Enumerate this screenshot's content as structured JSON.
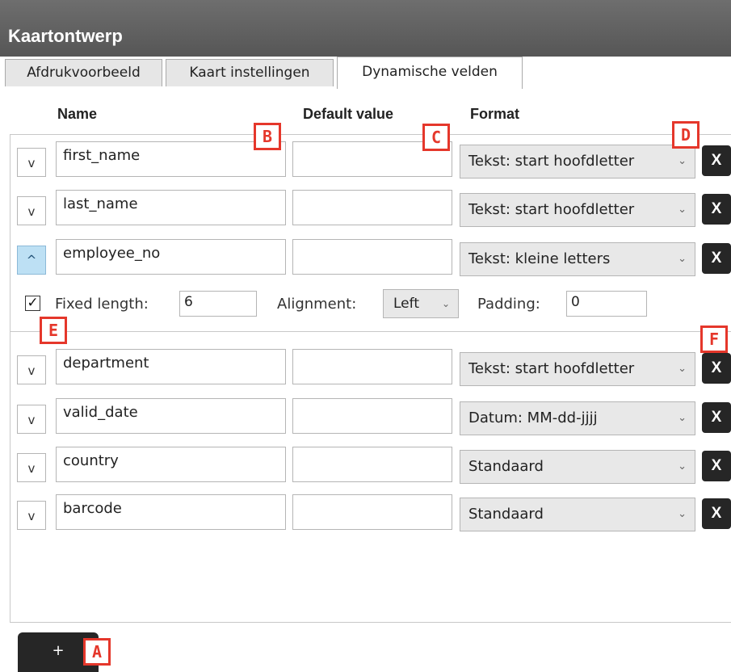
{
  "window": {
    "title": "Kaartontwerp"
  },
  "tabs": [
    {
      "label": "Afdrukvoorbeeld",
      "active": false
    },
    {
      "label": "Kaart instellingen",
      "active": false
    },
    {
      "label": "Dynamische velden",
      "active": true
    }
  ],
  "columns": {
    "name": "Name",
    "default_value": "Default value",
    "format": "Format"
  },
  "rows": [
    {
      "toggle": "v",
      "name": "first_name",
      "default_value": "",
      "format": "Tekst: start hoofdletter",
      "delete": "X"
    },
    {
      "toggle": "v",
      "name": "last_name",
      "default_value": "",
      "format": "Tekst: start hoofdletter",
      "delete": "X"
    },
    {
      "toggle": "^",
      "name": "employee_no",
      "default_value": "",
      "format": "Tekst: kleine letters",
      "delete": "X"
    },
    {
      "toggle": "v",
      "name": "department",
      "default_value": "",
      "format": "Tekst: start hoofdletter",
      "delete": "X"
    },
    {
      "toggle": "v",
      "name": "valid_date",
      "default_value": "",
      "format": "Datum: MM-dd-jjjj",
      "delete": "X"
    },
    {
      "toggle": "v",
      "name": "country",
      "default_value": "",
      "format": "Standaard",
      "delete": "X"
    },
    {
      "toggle": "v",
      "name": "barcode",
      "default_value": "",
      "format": "Standaard",
      "delete": "X"
    }
  ],
  "expanded_options": {
    "checkbox_mark": "✓",
    "fixed_length_checked": true,
    "fixed_length_label": "Fixed length:",
    "fixed_length_value": "6",
    "alignment_label": "Alignment:",
    "alignment_value": "Left",
    "padding_label": "Padding:",
    "padding_value": "0"
  },
  "add_button": {
    "label": "+"
  },
  "chevron_glyph": "⌄",
  "markers": {
    "a": "A",
    "b": "B",
    "c": "C",
    "d": "D",
    "e": "E",
    "f": "F"
  },
  "colors": {
    "titlebar": "#5f5f5f",
    "marker": "#e5372b",
    "delete_button": "#262626",
    "expanded_toggle": "#bde0f4",
    "select_bg": "#e8e8e8"
  }
}
